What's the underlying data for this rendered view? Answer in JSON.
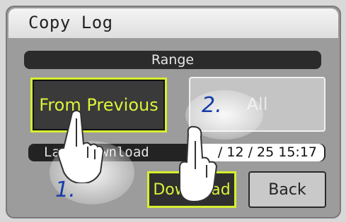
{
  "window": {
    "title": "Copy Log"
  },
  "range": {
    "label": "Range"
  },
  "buttons": {
    "from_previous": "From Previous",
    "all": "All",
    "download": "Download",
    "back": "Back"
  },
  "last_download": {
    "label": "Last Download",
    "value": "/ 12 / 25 15:17"
  },
  "steps": {
    "step1": "1.",
    "step2": "2."
  },
  "colors": {
    "accent": "#d7ef2e",
    "panel": "#9c9c9c"
  },
  "icons": {
    "pointer": "pointing-hand-icon"
  }
}
